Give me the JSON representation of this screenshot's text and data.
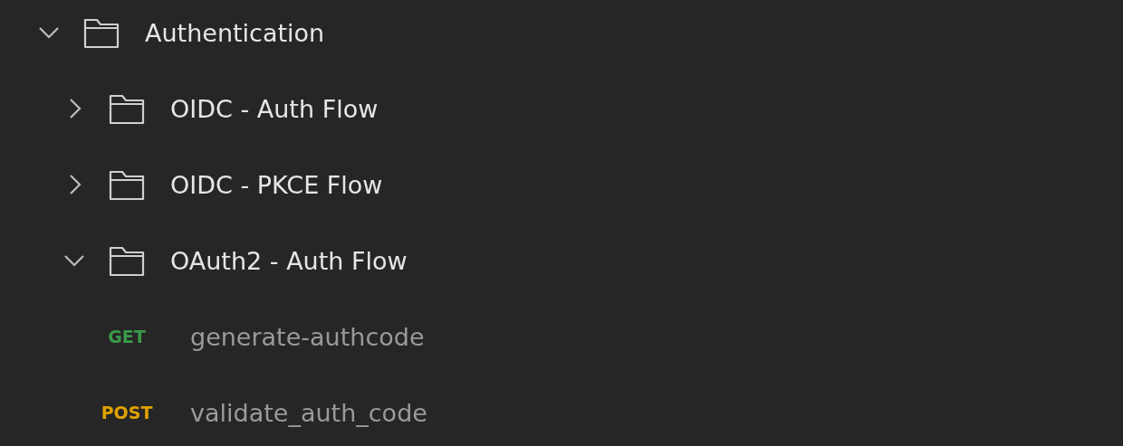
{
  "tree": [
    {
      "kind": "folder",
      "label": "Authentication",
      "expanded": true,
      "children": [
        {
          "kind": "folder",
          "label": "OIDC - Auth Flow",
          "expanded": false
        },
        {
          "kind": "folder",
          "label": "OIDC - PKCE Flow",
          "expanded": false
        },
        {
          "kind": "folder",
          "label": "OAuth2 - Auth Flow",
          "expanded": true,
          "children": [
            {
              "kind": "request",
              "method": "GET",
              "color": "#3a9a4a",
              "label": "generate-authcode"
            },
            {
              "kind": "request",
              "method": "POST",
              "color": "#e0a100",
              "label": "validate_auth_code"
            }
          ]
        }
      ]
    }
  ]
}
